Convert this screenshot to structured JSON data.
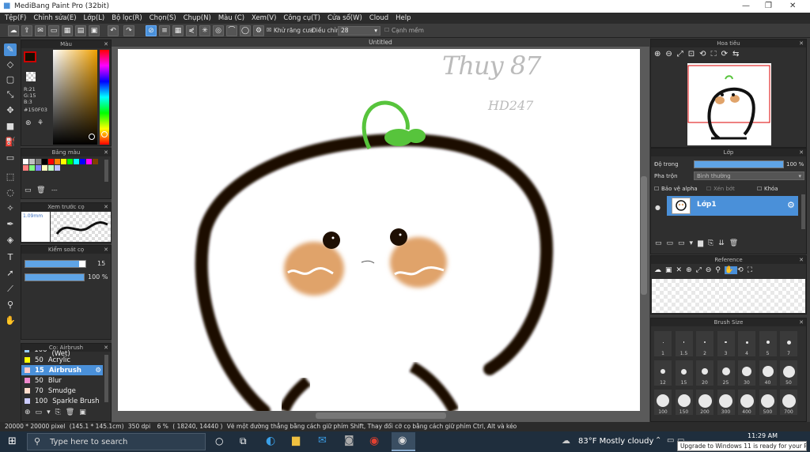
{
  "window": {
    "title": "MediBang Paint Pro (32bit)"
  },
  "menu": [
    "Tệp(F)",
    "Chỉnh sửa(E)",
    "Lớp(L)",
    "Bộ lọc(R)",
    "Chọn(S)",
    "Chụp(N)",
    "Màu (C)",
    "Xem(V)",
    "Công cụ(T)",
    "Cửa sổ(W)",
    "Cloud",
    "Help"
  ],
  "toolbar": {
    "antialias_label": "Khử răng cưa",
    "adjust_label": "Điều chỉnh",
    "adjust_value": "28",
    "soft_edge_label": "Cạnh mềm"
  },
  "canvas": {
    "tab_title": "Untitled",
    "signature": "Thuy 87",
    "signature_sub": "HD247"
  },
  "color_panel": {
    "title": "Màu",
    "r": "R:21",
    "g": "G:15",
    "b": "B:3",
    "hex": "#150F03",
    "fg_color": "#150F03"
  },
  "palette_panel": {
    "title": "Bảng màu",
    "dash": "---",
    "swatches": [
      "#ffffff",
      "#c0c0c0",
      "#808080",
      "#000000",
      "#ff0000",
      "#ff8000",
      "#ffff00",
      "#00ff00",
      "#00ffff",
      "#0000ff",
      "#ff00ff",
      "#804000",
      "#ff8080",
      "#80ff80",
      "#8080ff",
      "#ffffc0",
      "#c0ffc0",
      "#c0c0ff"
    ]
  },
  "preview_panel": {
    "title": "Xem trước cọ",
    "size": "1.09mm"
  },
  "brush_control": {
    "title": "Kiểm soát cọ",
    "size_value": "15",
    "opacity_value": "100 %",
    "size_fraction": 0.9,
    "opacity_fraction": 1.0
  },
  "brush_list": {
    "title": "Cọ: Airbrush",
    "items": [
      {
        "size": "100",
        "name": "Watercolor (Wet)"
      },
      {
        "size": "50",
        "name": "Acrylic"
      },
      {
        "size": "15",
        "name": "Airbrush",
        "selected": true
      },
      {
        "size": "50",
        "name": "Blur"
      },
      {
        "size": "70",
        "name": "Smudge"
      },
      {
        "size": "100",
        "name": "Sparkle Brush"
      }
    ]
  },
  "navigator": {
    "title": "Hoa tiêu"
  },
  "layer_panel": {
    "title": "Lớp",
    "opacity_label": "Độ trong",
    "opacity_value": "100 %",
    "blend_label": "Pha trộn",
    "blend_value": "Bình thường",
    "protect_alpha": "Bảo vệ alpha",
    "clipping": "Xén bớt",
    "lock": "Khóa",
    "layer_name": "Lớp1"
  },
  "reference": {
    "title": "Reference"
  },
  "brush_size": {
    "title": "Brush Size",
    "sizes": [
      "1",
      "1.5",
      "2",
      "3",
      "4",
      "5",
      "7",
      "12",
      "15",
      "20",
      "25",
      "30",
      "40",
      "50",
      "100",
      "150",
      "200",
      "300",
      "400",
      "500",
      "700"
    ]
  },
  "status": {
    "dims": "20000 * 20000 pixel",
    "mm": "(145.1 * 145.1cm)",
    "dpi": "350 dpi",
    "zoom": "6 %",
    "coords": "( 18240, 14440 )",
    "hint": "Vẽ một đường thẳng bằng cách giữ phím Shift, Thay đổi cỡ cọ bằng cách giữ phím Ctrl, Alt và kéo"
  },
  "taskbar": {
    "search": "Type here to search",
    "weather": "83°F  Mostly cloudy",
    "time": "11:29 AM",
    "notification": "Upgrade to Windows 11 is ready for your PC."
  }
}
